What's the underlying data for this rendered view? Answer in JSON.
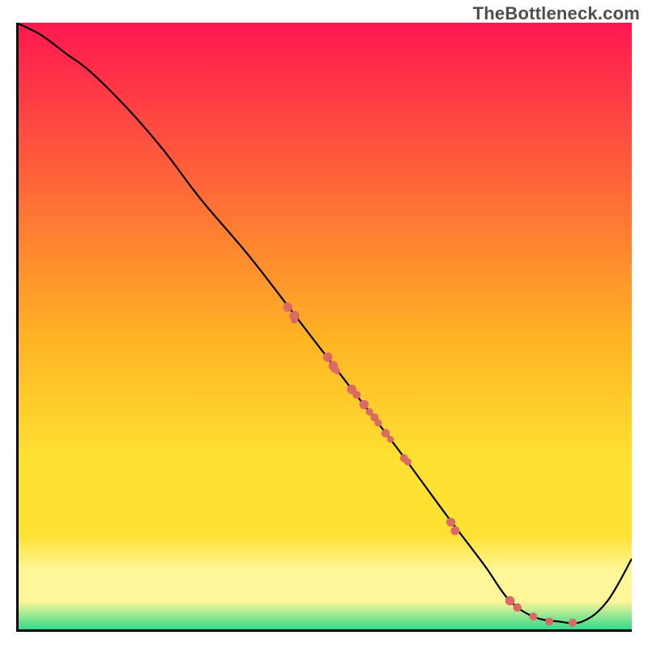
{
  "watermark": "TheBottleneck.com",
  "chart_data": {
    "type": "line",
    "title": "",
    "xlabel": "",
    "ylabel": "",
    "xlim": [
      0,
      100
    ],
    "ylim": [
      0,
      100
    ],
    "grid": false,
    "legend": false,
    "series": [
      {
        "name": "curve",
        "style": "line",
        "color": "#000000",
        "x": [
          0,
          4,
          8,
          12,
          18,
          24,
          30,
          38,
          46,
          54,
          62,
          70,
          76,
          80,
          84,
          88,
          92,
          96,
          100
        ],
        "y": [
          100,
          98,
          95,
          92,
          86,
          79,
          71,
          61.5,
          51,
          40.5,
          30,
          19,
          11,
          5.3,
          2.5,
          1.7,
          1.7,
          5,
          12
        ]
      },
      {
        "name": "markers",
        "style": "scatter",
        "color": "#da6a62",
        "points": [
          {
            "x": 44.1,
            "y": 53.3,
            "r": 5.8
          },
          {
            "x": 45.2,
            "y": 51.9,
            "r": 6.0
          },
          {
            "x": 45.2,
            "y": 51.2,
            "r": 4.5
          },
          {
            "x": 50.6,
            "y": 45.1,
            "r": 5.8
          },
          {
            "x": 51.5,
            "y": 43.7,
            "r": 5.8
          },
          {
            "x": 51.7,
            "y": 43.2,
            "r": 5.0
          },
          {
            "x": 52.1,
            "y": 42.8,
            "r": 4.0
          },
          {
            "x": 54.5,
            "y": 39.8,
            "r": 5.8
          },
          {
            "x": 55.3,
            "y": 38.9,
            "r": 5.0
          },
          {
            "x": 56.5,
            "y": 37.3,
            "r": 5.8
          },
          {
            "x": 57.4,
            "y": 36.1,
            "r": 4.5
          },
          {
            "x": 58.2,
            "y": 35.2,
            "r": 5.0
          },
          {
            "x": 58.8,
            "y": 34.3,
            "r": 4.5
          },
          {
            "x": 60.0,
            "y": 32.6,
            "r": 5.2
          },
          {
            "x": 60.8,
            "y": 31.6,
            "r": 4.2
          },
          {
            "x": 63.0,
            "y": 28.5,
            "r": 5.0
          },
          {
            "x": 63.6,
            "y": 27.9,
            "r": 4.5
          },
          {
            "x": 70.6,
            "y": 18.0,
            "r": 5.5
          },
          {
            "x": 71.3,
            "y": 16.6,
            "r": 5.5
          },
          {
            "x": 80.2,
            "y": 5.1,
            "r": 5.8
          },
          {
            "x": 81.4,
            "y": 4.0,
            "r": 5.2
          },
          {
            "x": 84.0,
            "y": 2.5,
            "r": 5.0
          },
          {
            "x": 86.6,
            "y": 1.7,
            "r": 5.0
          },
          {
            "x": 90.4,
            "y": 1.5,
            "r": 5.0
          }
        ]
      }
    ],
    "background_gradient": {
      "top": "#ff1750",
      "mid1": "#ff6b37",
      "mid2": "#ffb424",
      "mid3": "#ffe132",
      "band": "#fff69a",
      "bottom": "#1fd789"
    }
  }
}
